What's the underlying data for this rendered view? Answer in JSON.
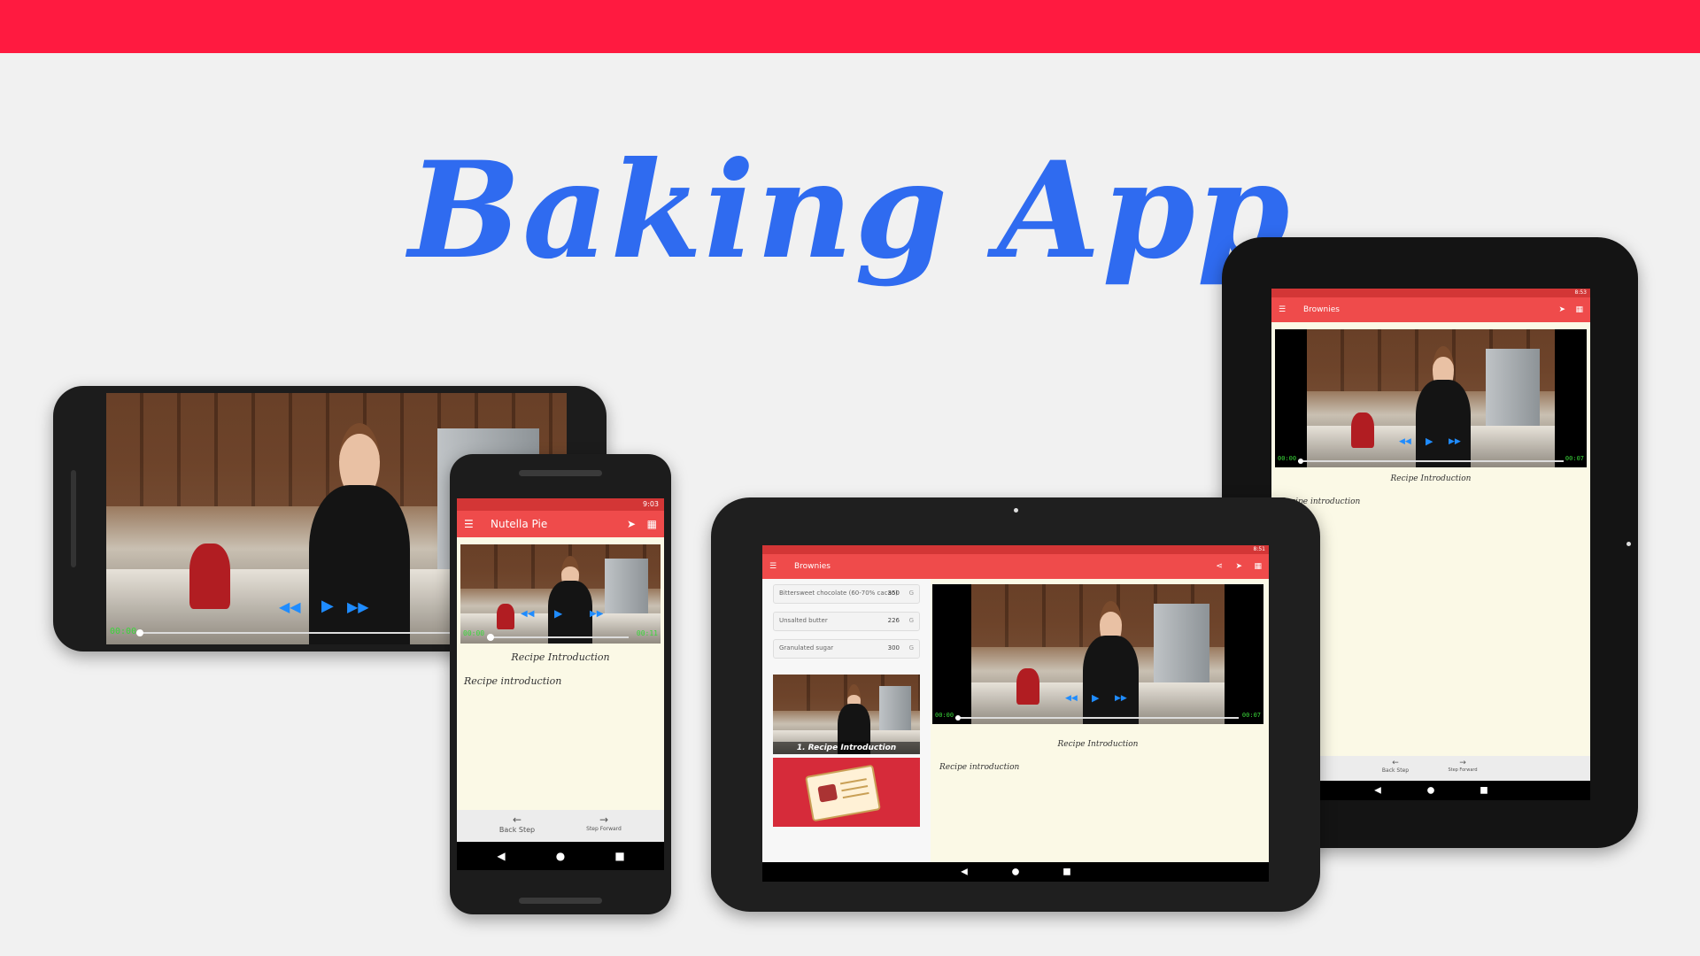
{
  "title": "Baking App",
  "phone_landscape": {
    "time_start": "00:00"
  },
  "phone_portrait": {
    "status_time": "9:03",
    "toolbar_title": "Nutella Pie",
    "time_start": "00:00",
    "time_end": "00:11",
    "step_title": "Recipe Introduction",
    "step_description": "Recipe introduction",
    "back_label": "Back Step",
    "forward_label": "Step Forward"
  },
  "tablet_landscape": {
    "status_time": "8:51",
    "toolbar_title": "Brownies",
    "ingredients": [
      {
        "name": "Bittersweet chocolate (60-70% cacao)",
        "qty": "350",
        "unit": "G"
      },
      {
        "name": "Unsalted butter",
        "qty": "226",
        "unit": "G"
      },
      {
        "name": "Granulated sugar",
        "qty": "300",
        "unit": "G"
      }
    ],
    "step_card_label": "1. Recipe Introduction",
    "time_start": "00:00",
    "time_end": "00:07",
    "step_title": "Recipe Introduction",
    "step_description": "Recipe introduction"
  },
  "tablet_portrait": {
    "status_time": "8:53",
    "toolbar_title": "Brownies",
    "time_start": "00:00",
    "time_end": "00:07",
    "step_title": "Recipe Introduction",
    "step_description": "Recipe introduction",
    "back_label": "Back Step",
    "forward_label": "Step Forward"
  },
  "colors": {
    "top_bar": "#ff1a40",
    "title": "#2f6bf0",
    "toolbar": "#ef4b4b",
    "status_bar": "#d33636",
    "content_bg": "#fbf9e6",
    "player_controls": "#1f8cff",
    "timer": "#39d739"
  },
  "icons": {
    "menu": "hamburger-icon",
    "send": "send-icon",
    "widget": "widget-grid-icon",
    "share": "share-icon",
    "back": "arrow-left-icon",
    "forward": "arrow-right-icon",
    "nav_back": "triangle-back-icon",
    "nav_home": "circle-home-icon",
    "nav_recents": "square-recents-icon"
  }
}
